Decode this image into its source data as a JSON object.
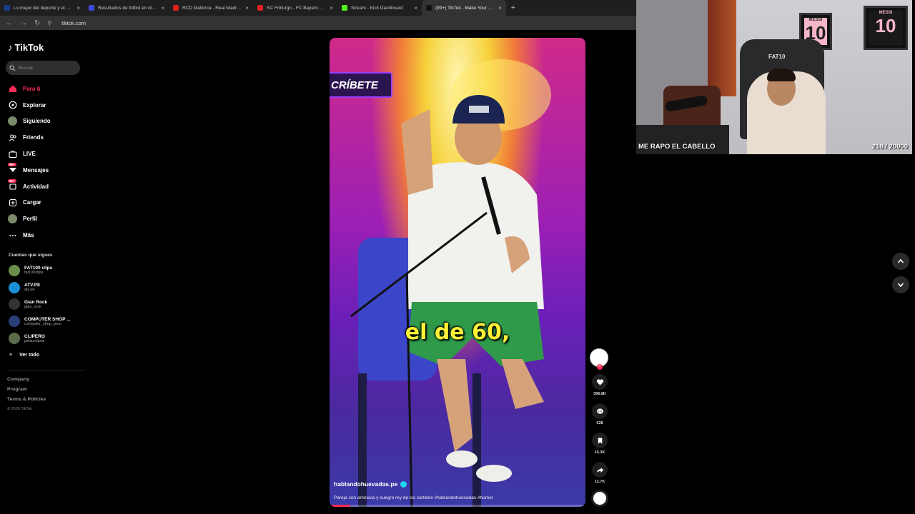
{
  "browser": {
    "tabs": [
      {
        "title": "Lo mejor del deporte y el entre",
        "color": "#1a3b8c",
        "active": false
      },
      {
        "title": "Resultados de fútbol en directo",
        "color": "#3a4bdc",
        "active": false
      },
      {
        "title": "RCD Mallorca - Real Madrid Fútb",
        "color": "#e02020",
        "active": false
      },
      {
        "title": "SC Friburgo - FC Bayern Munich",
        "color": "#e02020",
        "active": false
      },
      {
        "title": "Stream - Kick Dashboard",
        "color": "#53fc18",
        "active": false
      },
      {
        "title": "(99+) TikTok - Make Your Day",
        "color": "#111111",
        "active": true
      }
    ],
    "new_tab": "+",
    "url": "tiktok.com"
  },
  "sidebar": {
    "logo": "TikTok",
    "search_placeholder": "Buscar",
    "menu": [
      {
        "label": "Para ti",
        "icon": "home-icon",
        "active": true
      },
      {
        "label": "Explorar",
        "icon": "compass-icon",
        "active": false
      },
      {
        "label": "Siguiendo",
        "icon": "following-avatar-icon",
        "active": false
      },
      {
        "label": "Friends",
        "icon": "friends-icon",
        "active": false
      },
      {
        "label": "LIVE",
        "icon": "live-icon",
        "active": false
      },
      {
        "label": "Mensajes",
        "icon": "messages-icon",
        "badge": "99+",
        "active": false
      },
      {
        "label": "Actividad",
        "icon": "activity-icon",
        "badge": "99+",
        "active": false
      },
      {
        "label": "Cargar",
        "icon": "upload-icon",
        "active": false
      },
      {
        "label": "Perfil",
        "icon": "profile-avatar-icon",
        "active": false
      },
      {
        "label": "Más",
        "icon": "more-icon",
        "active": false
      }
    ],
    "following_title": "Cuentas que sigues",
    "accounts": [
      {
        "name": "FAT100 clips",
        "handle": "fat100clips",
        "color": "#6b8f4a"
      },
      {
        "name": "ATV.PE",
        "handle": "atv.pe",
        "color": "#1a8fd6"
      },
      {
        "name": "Gian Rock",
        "handle": "gian_rock",
        "color": "#333333"
      },
      {
        "name": "COMPUTER SHOP ...",
        "handle": "computer_shop_peru",
        "color": "#2a3f7a"
      },
      {
        "name": "CLIPERO",
        "handle": "peliaoclipsx",
        "color": "#5a6b4a"
      }
    ],
    "see_all": "Ver todo",
    "footer": [
      "Company",
      "Program",
      "Terms & Policies"
    ],
    "copyright": "© 2026 TikTok"
  },
  "video": {
    "banner_text": "CRÍBETE",
    "caption": "el de 60,",
    "author": "hablandohuevadas.pe",
    "description": "Pareja con amnesia y suegro rey de los carteles #hablandohuevadas #humor",
    "progress": 0.08
  },
  "actions": {
    "likes": "396.8K",
    "comments": "628",
    "saves": "15.3K",
    "shares": "12.7K"
  },
  "webcam": {
    "title": "ME RAPO EL CABELLO",
    "counter": "218 / 20000",
    "poster1_text": "MESSI",
    "poster1_number": "10",
    "poster2_text": "MESSI",
    "poster2_number": "10",
    "chair_text": "FAT10"
  }
}
